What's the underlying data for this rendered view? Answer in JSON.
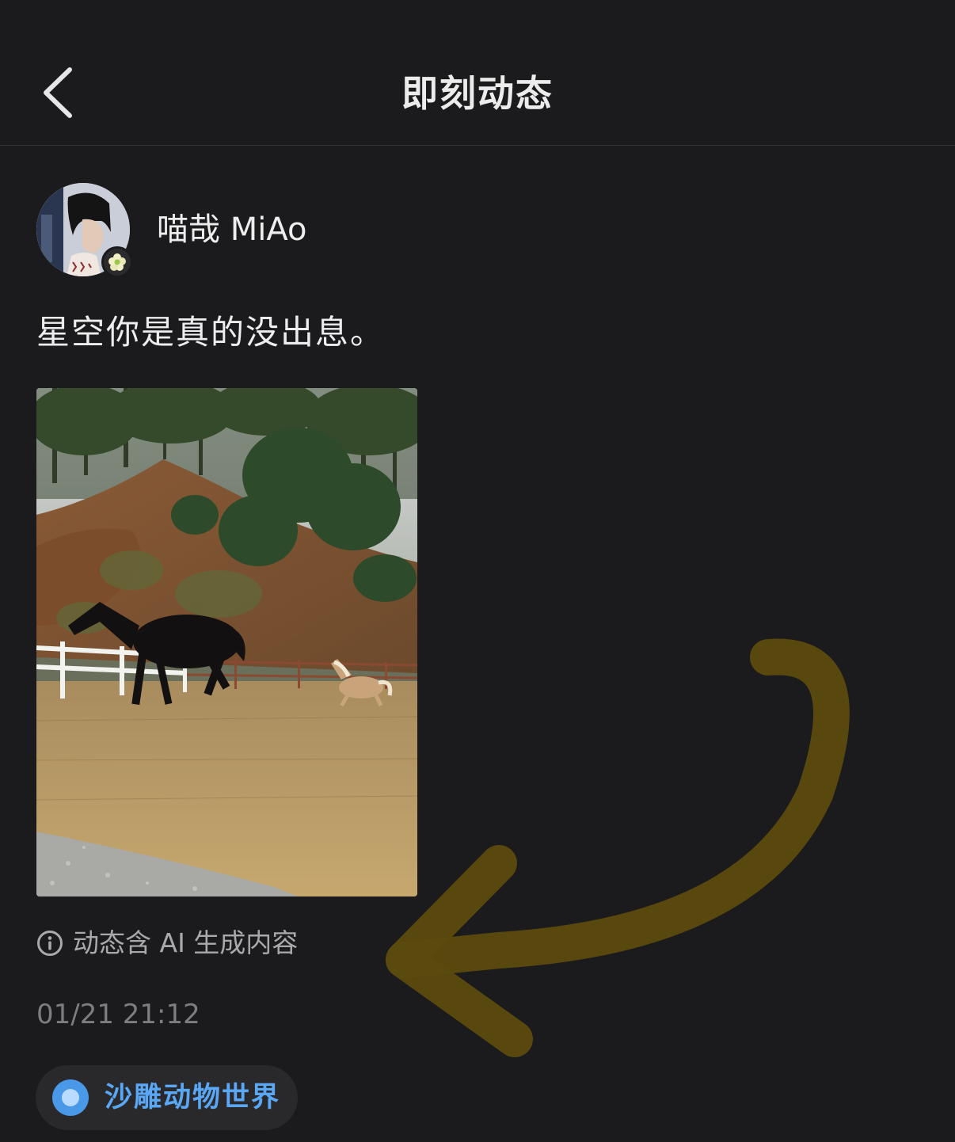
{
  "header": {
    "title": "即刻动态"
  },
  "post": {
    "author_name": "喵哉 MiAo",
    "text": "星空你是真的没出息。",
    "ai_notice": "动态含 AI 生成内容",
    "timestamp": "01/21 21:12",
    "topic_label": "沙雕动物世界"
  },
  "colors": {
    "background": "#1b1b1d",
    "topic_accent": "#5aa7f5",
    "annotation_arrow": "#6e5a10"
  },
  "icons": {
    "back": "chevron-left-icon",
    "badge": "flower-badge-icon",
    "info": "info-circle-icon",
    "topic": "topic-dot-icon"
  }
}
